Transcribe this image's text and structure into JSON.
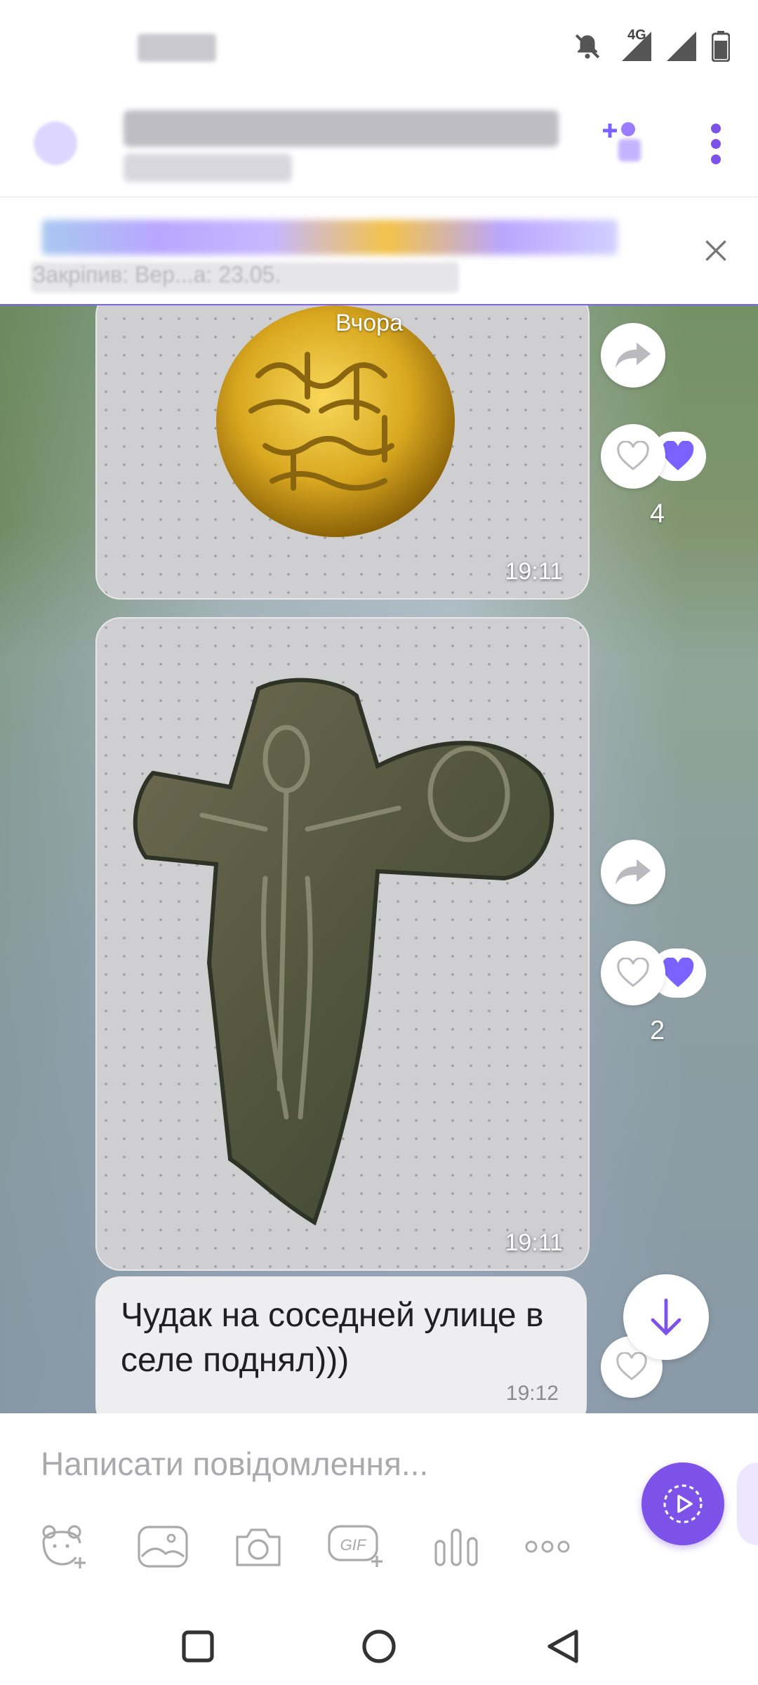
{
  "status_bar": {
    "network_label": "4G"
  },
  "header": {
    "more_icon": "more-vertical-icon",
    "add_member_icon": "add-member-icon"
  },
  "pinned": {
    "text": "Закріпив: Вер...а: 23.05."
  },
  "chat": {
    "date_label": "Вчора",
    "messages": [
      {
        "type": "image",
        "subject": "gold coin",
        "time": "19:11",
        "likes": "4"
      },
      {
        "type": "image",
        "subject": "bronze cross",
        "time": "19:11",
        "likes": "2"
      },
      {
        "type": "text",
        "text": "Чудак на соседней улице в селе поднял)))",
        "time": "19:12"
      }
    ]
  },
  "composer": {
    "placeholder": "Написати повідомлення..."
  },
  "colors": {
    "accent": "#7d52e8",
    "like": "#7b61ff"
  }
}
